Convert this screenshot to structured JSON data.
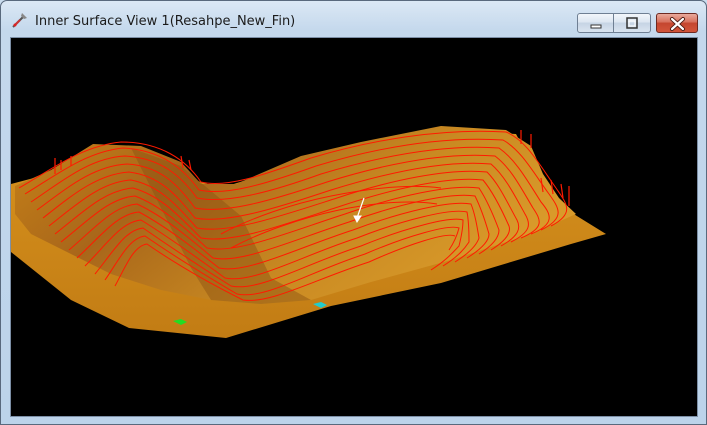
{
  "window": {
    "title": "Inner Surface View 1(Resahpe_New_Fin)",
    "icon": "surface-view-app-icon",
    "buttons": {
      "minimize_icon": "minimize-icon",
      "maximize_icon": "restore-icon",
      "close_icon": "close-icon"
    }
  },
  "viewport": {
    "background": "#000000",
    "surface_color": "#d9901f",
    "contour_color": "#ff1a00",
    "markers": [
      {
        "name": "green-marker",
        "color": "#22dd22"
      },
      {
        "name": "cyan-marker",
        "color": "#22cccc"
      },
      {
        "name": "white-arrow-cursor",
        "color": "#ffffff"
      }
    ]
  }
}
